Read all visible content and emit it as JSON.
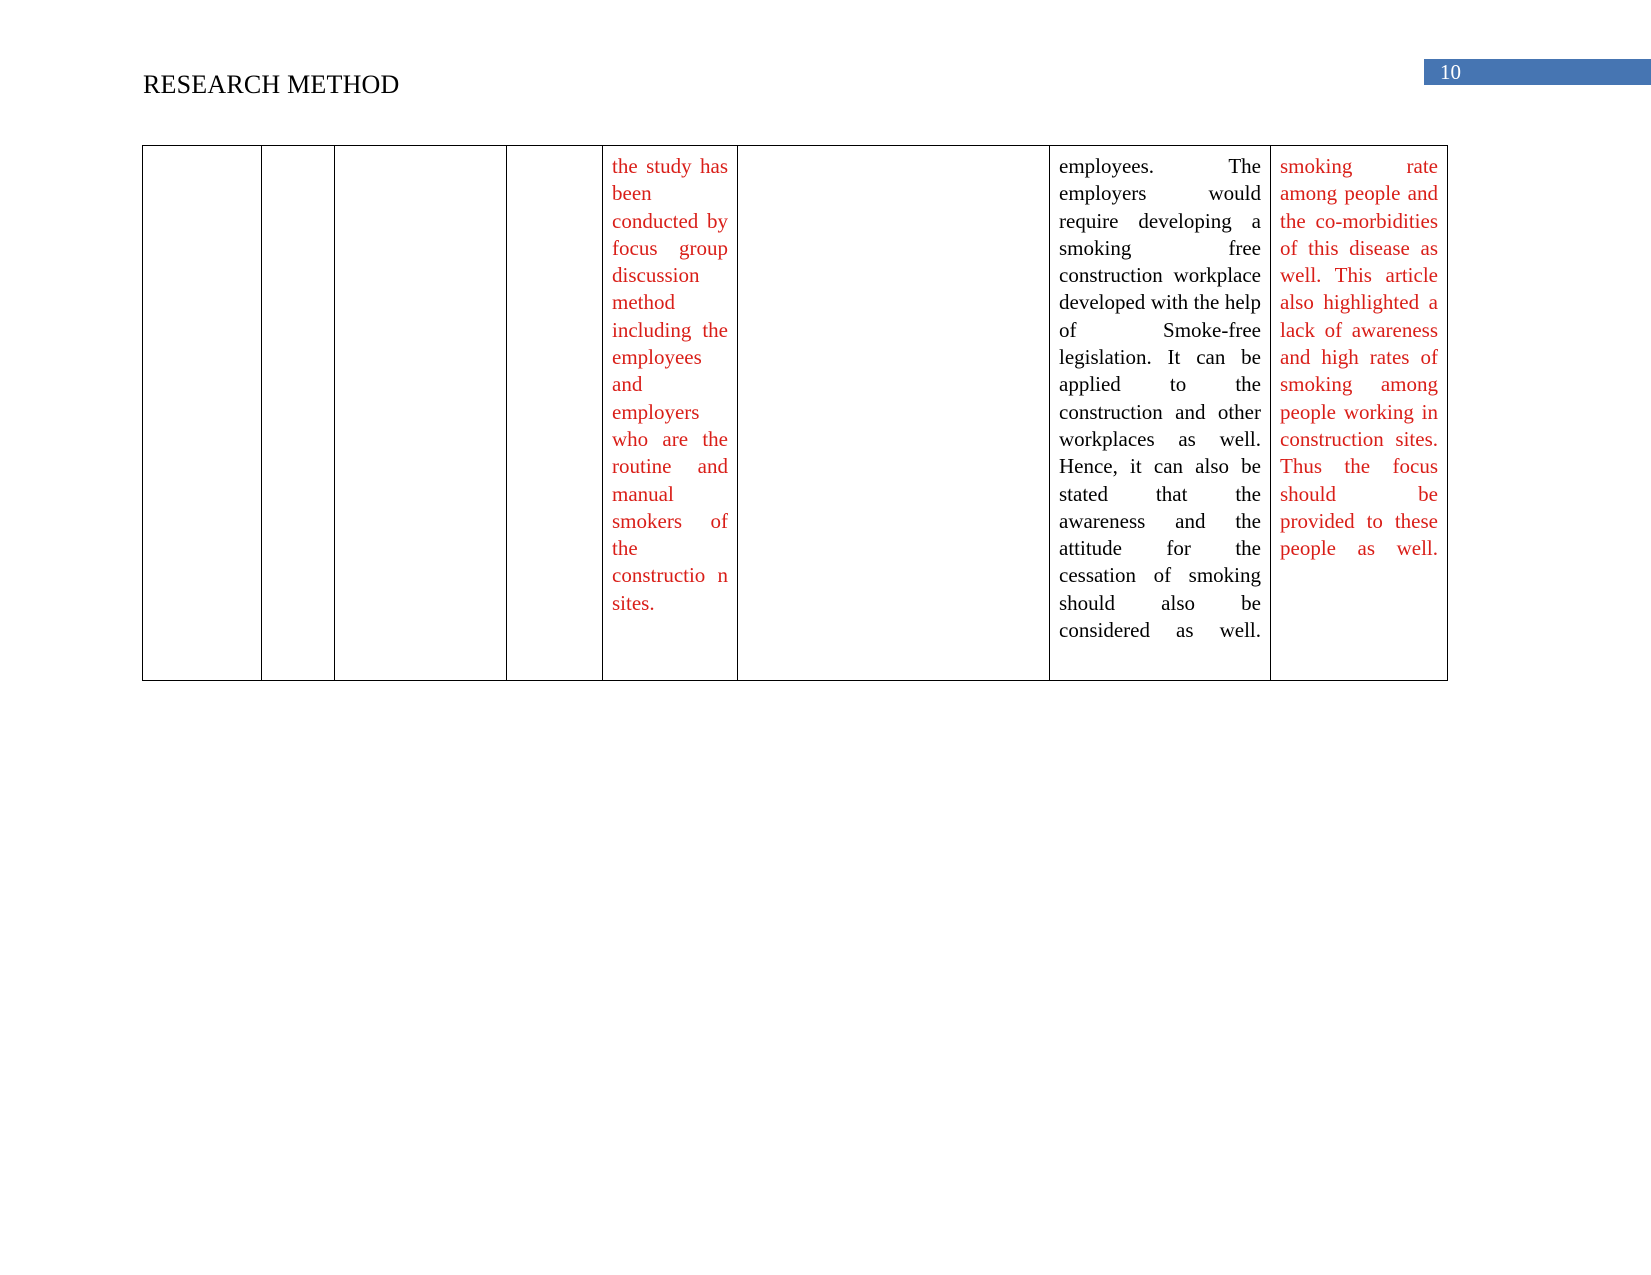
{
  "header": {
    "title": "RESEARCH METHOD",
    "page_number": "10",
    "badge_color": "#4675b2",
    "badge_text_color": "#ffffff"
  },
  "colors": {
    "red_text": "#d91e18",
    "black_text": "#000000",
    "table_border": "#000000",
    "page_background": "#ffffff"
  },
  "table": {
    "column_count": 8,
    "row_count": 1,
    "rows": [
      {
        "cells": [
          {
            "text": "",
            "color": "black",
            "empty": true
          },
          {
            "text": "",
            "color": "black",
            "empty": true
          },
          {
            "text": "",
            "color": "black",
            "empty": true
          },
          {
            "text": "",
            "color": "black",
            "empty": true
          },
          {
            "text": "the study has been conducted by focus group discussion method including the employees and employers who are the routine and manual smokers of the constructio n sites.",
            "color": "red",
            "empty": false
          },
          {
            "text": "",
            "color": "black",
            "empty": true
          },
          {
            "text": "employees. The employers would require developing a smoking free construction workplace developed with the help of Smoke-free legislation. It can be applied to the construction and other workplaces as well. Hence, it can also be stated that the awareness and the attitude for the cessation of smoking should also be considered as well.",
            "color": "black",
            "empty": false
          },
          {
            "text": "smoking rate among people and the co-morbidities of this disease as well. This article also highlighted a lack of awareness and high rates of smoking among people working in construction sites. Thus the focus should be provided to these people as well.",
            "color": "red",
            "empty": false
          }
        ]
      }
    ]
  }
}
